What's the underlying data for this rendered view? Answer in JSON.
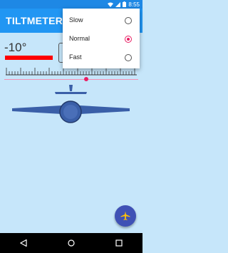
{
  "status": {
    "time": "8:55"
  },
  "app": {
    "title": "TILTMETER"
  },
  "reading": {
    "angle": "-10°"
  },
  "menu": {
    "items": [
      {
        "label": "Slow",
        "checked": false
      },
      {
        "label": "Normal",
        "checked": true
      },
      {
        "label": "Fast",
        "checked": false
      }
    ]
  },
  "icons": {
    "fab": "airplane-icon",
    "nav": [
      "back-icon",
      "home-icon",
      "recents-icon"
    ],
    "status": [
      "wifi-icon",
      "signal-icon",
      "battery-icon"
    ]
  },
  "colors": {
    "appbar": "#2196f3",
    "statusbar": "#1e88e5",
    "accent": "#e91e63",
    "fab": "#3f51b5",
    "tilt_bar": "#ff0000",
    "background": "#c6e6fa"
  }
}
